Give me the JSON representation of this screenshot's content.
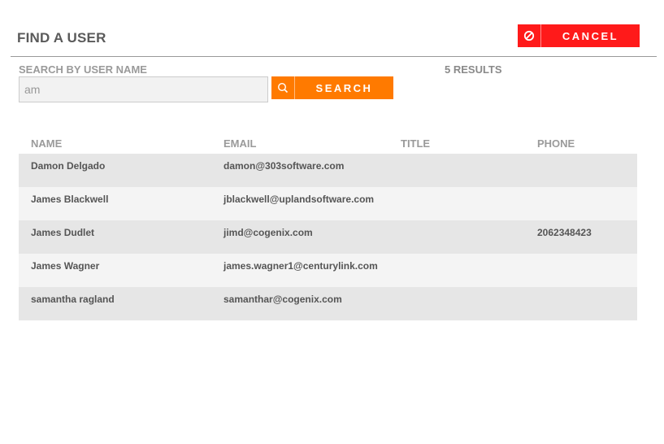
{
  "dialog": {
    "title": "FIND A USER",
    "cancel_label": "CANCEL"
  },
  "search": {
    "label": "SEARCH BY USER NAME",
    "value": "am",
    "button_label": "SEARCH",
    "results_text": "5 RESULTS"
  },
  "colors": {
    "cancel": "#ff1a1a",
    "search": "#ff7a00"
  },
  "table": {
    "headers": [
      "NAME",
      "EMAIL",
      "TITLE",
      "PHONE"
    ],
    "rows": [
      {
        "name": "Damon Delgado",
        "email": "damon@303software.com",
        "title": "",
        "phone": ""
      },
      {
        "name": "James Blackwell",
        "email": "jblackwell@uplandsoftware.com",
        "title": "",
        "phone": ""
      },
      {
        "name": "James Dudlet",
        "email": "jimd@cogenix.com",
        "title": "",
        "phone": "2062348423"
      },
      {
        "name": "James Wagner",
        "email": "james.wagner1@centurylink.com",
        "title": "",
        "phone": ""
      },
      {
        "name": "samantha ragland",
        "email": "samanthar@cogenix.com",
        "title": "",
        "phone": ""
      }
    ]
  }
}
